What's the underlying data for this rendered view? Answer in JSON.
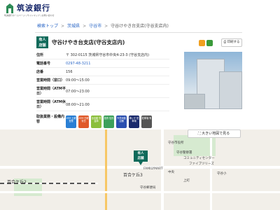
{
  "header": {
    "brand": "筑波銀行",
    "sub": "筑波銀行ホームページ | サイトマップ | お問い合わせ"
  },
  "breadcrumb": [
    "検索トップ",
    "茨城県",
    "守谷市",
    "守谷けやき台支店(守谷支店内)"
  ],
  "branch": {
    "badge_line1": "有人",
    "badge_line2": "店舗",
    "title": "守谷けやき台支店(守谷支店内)"
  },
  "actions": {
    "print_label": "印刷する"
  },
  "info": {
    "rows": [
      {
        "label": "住所",
        "value": "〒 302-0115 茨城県守谷市中央4-23-3 (守谷支店内)",
        "link": false
      },
      {
        "label": "電話番号",
        "value": "0297-48-3211",
        "link": true
      },
      {
        "label": "店番",
        "value": "156",
        "link": false
      },
      {
        "label": "営業時間（窓口）",
        "value": "09:00～15:00",
        "link": false
      },
      {
        "label": "営業時間（ATM平日）",
        "value": "07:00～23:00",
        "link": false
      },
      {
        "label": "営業時間（ATM休日）",
        "value": "08:00～21:00",
        "link": false
      },
      {
        "label": "取扱業務・設備内容",
        "value": "",
        "link": false
      }
    ]
  },
  "facilities": [
    {
      "label": "ATM 土曜 営業",
      "color": "#2a7fd4"
    },
    {
      "label": "ATM 日曜 祝日",
      "color": "#e05a2a"
    },
    {
      "label": "全自動 貸金庫",
      "color": "#8bbf3c"
    },
    {
      "label": "投資 信託",
      "color": "#3ca05a"
    },
    {
      "label": "外貨両替 店舗",
      "color": "#2a4fb0"
    },
    {
      "label": "車いす 駐車場",
      "color": "#1a2a6c"
    },
    {
      "label": "駐車場 有",
      "color": "#555555"
    }
  ],
  "map": {
    "larger_map_label": "大きい地図で見る",
    "pin_line1": "有人",
    "pin_line2": "店舗",
    "labels": {
      "a": "守谷市役所",
      "b": "守谷警察署",
      "c": "百合ケ丘3",
      "d": "百合ケ丘2",
      "e": "中央",
      "f": "守谷小",
      "g": "FAMILYMART",
      "h": "コミュニティセンター",
      "i": "ファイブツリーズ",
      "j": "上町",
      "k": "守谷郵便局"
    }
  },
  "colors": {
    "brand": "#1a2a6c",
    "badge": "#0f6a5a",
    "link": "#2a66c6"
  }
}
